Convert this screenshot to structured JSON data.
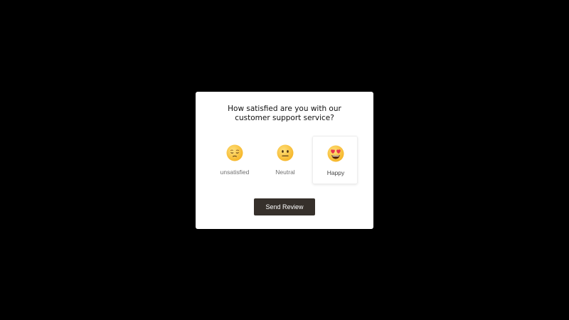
{
  "survey": {
    "question_line1": "How satisfied are you with our",
    "question_line2": "customer support service?",
    "options": [
      {
        "label": "unsatisfied",
        "icon": "pensive-face-icon",
        "selected": false
      },
      {
        "label": "Neutral",
        "icon": "neutral-face-icon",
        "selected": false
      },
      {
        "label": "Happy",
        "icon": "heart-eyes-face-icon",
        "selected": true
      }
    ],
    "send_label": "Send Review"
  },
  "colors": {
    "backdrop": "#000000",
    "card": "#ffffff",
    "button": "#36302b",
    "emoji": "#ffcc33"
  }
}
